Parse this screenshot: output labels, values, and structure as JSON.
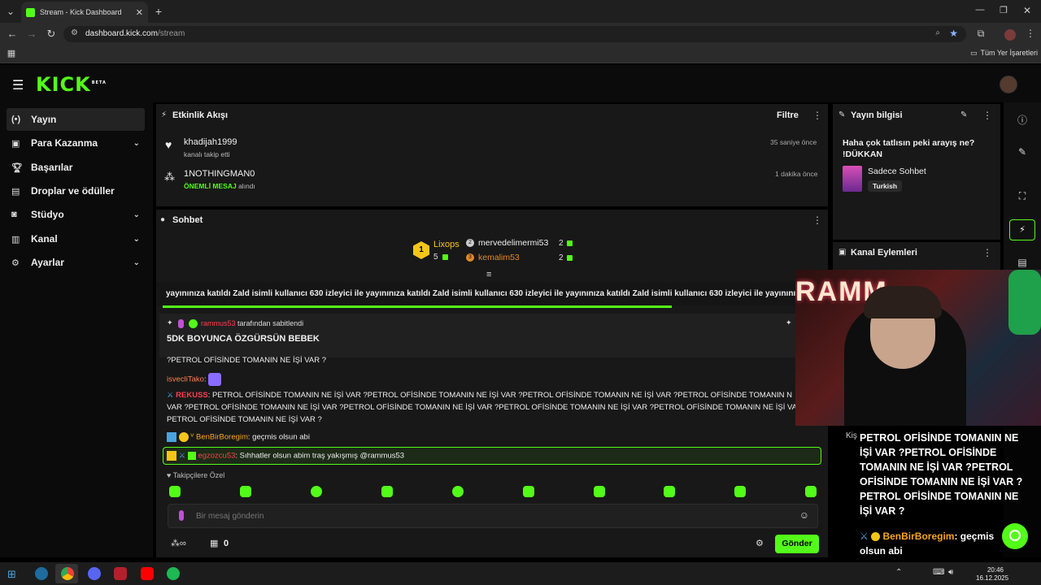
{
  "browser": {
    "tab_title": "Stream - Kick Dashboard",
    "url_host": "dashboard.kick.com",
    "url_path": "/stream",
    "bookmarks_label": "Tüm Yer İşaretleri"
  },
  "header": {
    "logo": "KICK",
    "beta": "BETA"
  },
  "sidebar": {
    "items": [
      {
        "label": "Yayın",
        "icon": "broadcast-icon"
      },
      {
        "label": "Para Kazanma",
        "icon": "money-icon"
      },
      {
        "label": "Başarılar",
        "icon": "trophy-icon"
      },
      {
        "label": "Droplar ve ödüller",
        "icon": "gift-icon"
      },
      {
        "label": "Stüdyo",
        "icon": "studio-icon"
      },
      {
        "label": "Kanal",
        "icon": "channel-icon"
      },
      {
        "label": "Ayarlar",
        "icon": "settings-icon"
      }
    ]
  },
  "activity": {
    "title": "Etkinlik Akışı",
    "filter": "Filtre",
    "events": [
      {
        "user": "khadijah1999",
        "text": "kanalı takip etti",
        "time": "35 saniye önce"
      },
      {
        "user": "1NOTHINGMAN0",
        "highlight": "ÖNEMLİ MESAJ",
        "text": "alındı",
        "time": "1 dakika önce"
      }
    ]
  },
  "chat": {
    "title": "Sohbet",
    "leaderboard": {
      "first_user": "Lixops",
      "first_count": "5",
      "second_user": "mervedelimermi53",
      "second_count": "2",
      "third_user": "kemalim53",
      "third_count": "2"
    },
    "ticker": "yayınınıza katıldı  Zald isimli kullanıcı 630 izleyici ile yayınınıza katıldı  Zald isimli kullanıcı 630 izleyici ile yayınınıza katıldı  Zald isimli kullanıcı 630 izleyici ile yayınınıza katıldı",
    "pinned_by": "rammus53",
    "pinned_label": "tarafından sabitlendi",
    "pinned_message": "5DK BOYUNCA ÖZGÜRSÜN BEBEK",
    "msg_cutoff": "?PETROL OFİSİNDE TOMANIN NE İŞİ VAR ?",
    "msg2_user": "isvecliTako",
    "msg3_user": "REKUSS",
    "msg3_line1": ": PETROL OFİSİNDE TOMANIN NE İŞİ VAR ?PETROL OFİSİNDE TOMANIN NE İŞİ VAR ?PETROL OFİSİNDE TOMANIN NE İŞİ VAR ?PETROL OFİSİNDE TOMANIN N",
    "msg3_line2": "VAR ?PETROL OFİSİNDE TOMANIN NE İŞİ VAR ?PETROL OFİSİNDE TOMANIN NE İŞİ VAR ?PETROL OFİSİNDE TOMANIN NE İŞİ VAR ?PETROL OFİSİNDE TOMANIN NE İŞİ VA",
    "msg3_line3": "PETROL OFİSİNDE TOMANIN NE İŞİ VAR ?",
    "msg4_user": "BenBirBoregim",
    "msg4_text": ": geçmis olsun abi",
    "msg5_user": "egzozcu53",
    "msg5_text": ": Sıhhatler olsun abim traş yakışmış @rammus53",
    "followers_only": "Takipçilere Özel",
    "input_placeholder": "Bir mesaj gönderin",
    "points_value": "0",
    "send": "Gönder"
  },
  "stream_info": {
    "title": "Yayın bilgisi",
    "stream_title": "Haha çok tatlısın peki arayış ne? !DÜKKAN",
    "category": "Sadece Sohbet",
    "language": "Turkish"
  },
  "channel_actions": {
    "title": "Kanal Eylemleri"
  },
  "overlay": {
    "cam_sign": "RAMM",
    "bigtext": "PETROL OFİSİNDE TOMANIN NE İŞİ VAR ?PETROL OFİSİNDE TOMANIN NE İŞİ VAR ?PETROL OFİSİNDE TOMANIN NE İŞİ VAR ?PETROL OFİSİNDE TOMANIN NE İŞİ VAR ?",
    "chat_user": "BenBirBoregim",
    "chat_text": ": geçmis olsun abi",
    "partial_left": "Kiş"
  },
  "taskbar": {
    "time": "20:46",
    "date": "16.12.2025"
  },
  "colors": {
    "accent": "#53fc18",
    "panel": "#181818",
    "bg": "#000000"
  }
}
